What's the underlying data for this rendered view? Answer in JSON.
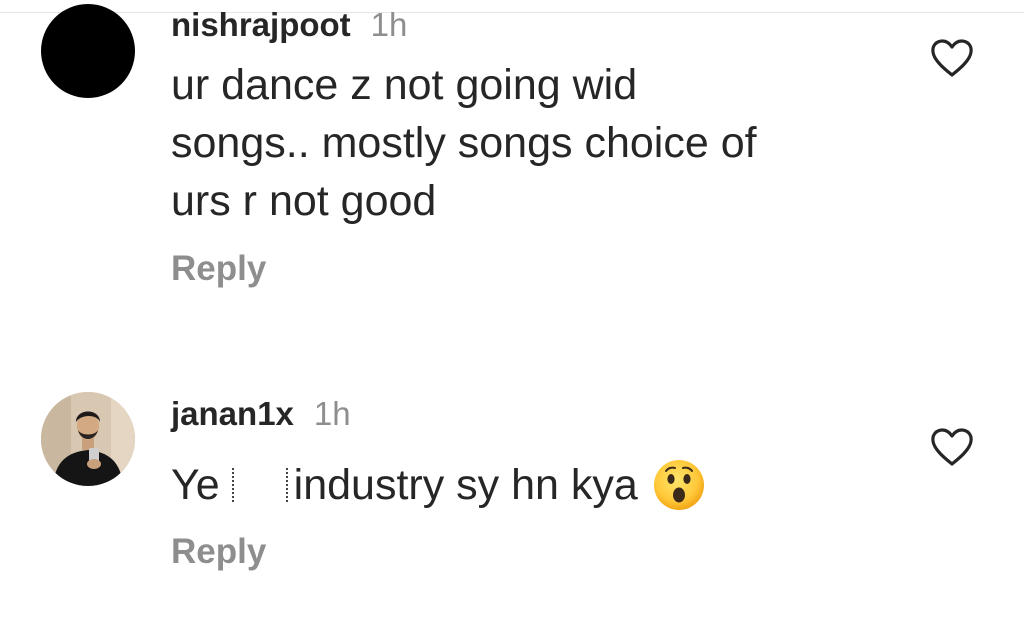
{
  "comments": [
    {
      "username": "nishrajpoot",
      "time": "1h",
      "text": "ur dance z not going wid\nsongs.. mostly songs choice of\nurs r not good",
      "reply_label": "Reply",
      "avatar": "black-circle"
    },
    {
      "username": "janan1x",
      "time": "1h",
      "text_before": "Ye",
      "text_after": "industry sy hn kya",
      "emoji": "astonished-face-emoji",
      "reply_label": "Reply",
      "avatar": "profile-photo"
    }
  ],
  "icons": {
    "like": "heart-outline-icon"
  },
  "colors": {
    "text": "#262626",
    "muted": "#8e8e8e",
    "background": "#ffffff"
  }
}
